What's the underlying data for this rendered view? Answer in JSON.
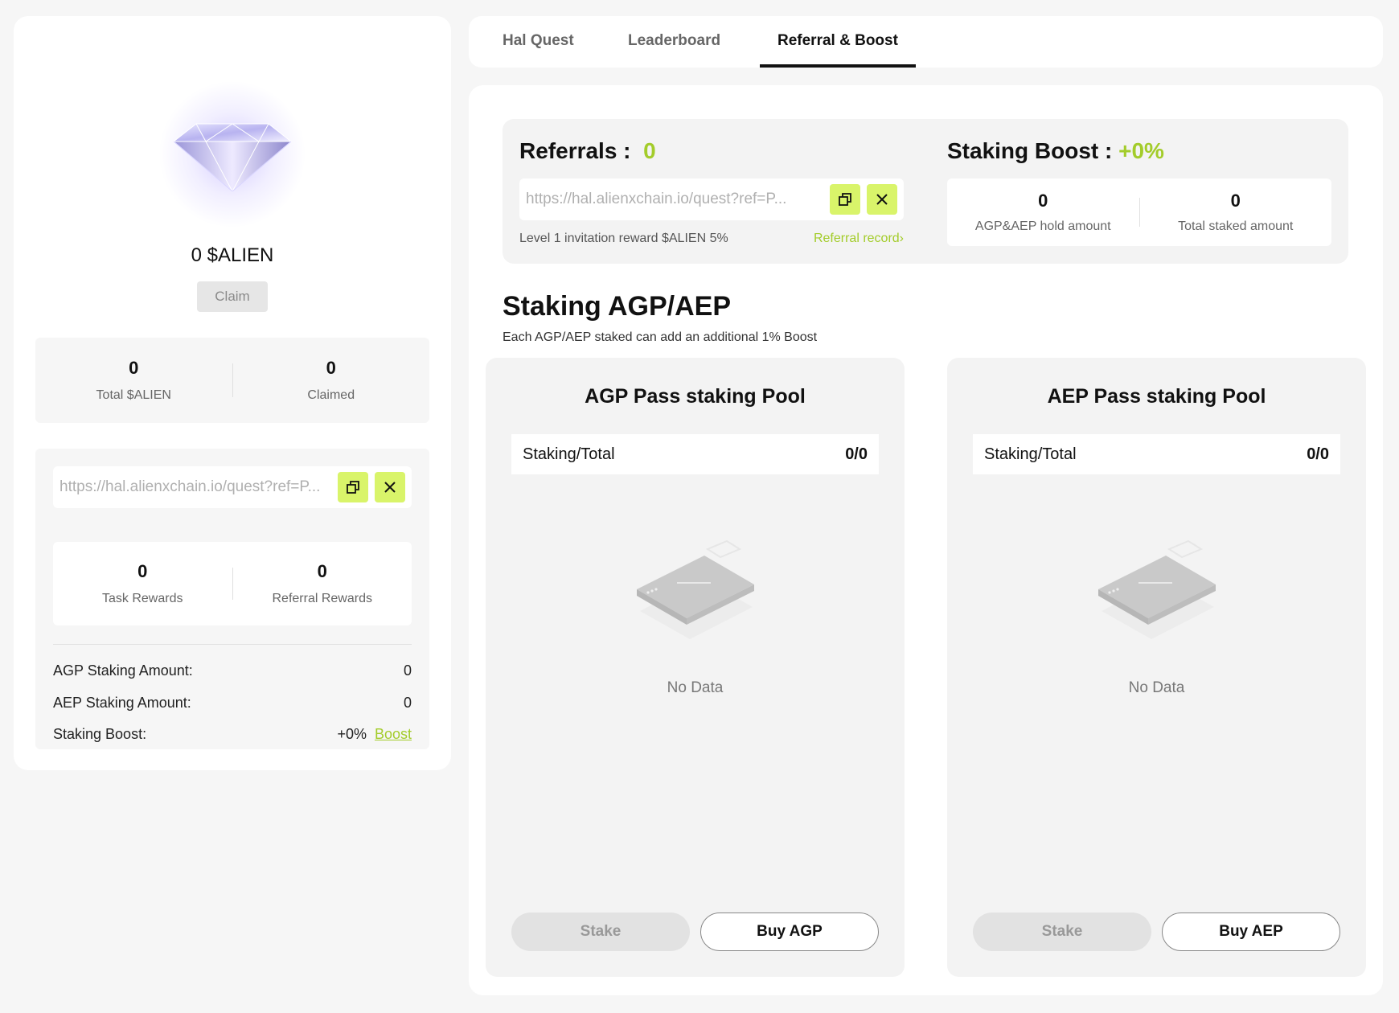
{
  "left_panel": {
    "alien_amount": "0 $ALIEN",
    "claim_label": "Claim",
    "stats": [
      {
        "value": "0",
        "label": "Total $ALIEN"
      },
      {
        "value": "0",
        "label": "Claimed"
      }
    ],
    "referral_link": "https://hal.alienxchain.io/quest?ref=P...",
    "rewards": [
      {
        "value": "0",
        "label": "Task Rewards"
      },
      {
        "value": "0",
        "label": "Referral Rewards"
      }
    ],
    "agp_staking_label": "AGP Staking Amount:",
    "agp_staking_value": "0",
    "aep_staking_label": "AEP Staking Amount:",
    "aep_staking_value": "0",
    "staking_boost_label": "Staking Boost:",
    "staking_boost_value": "+0%",
    "boost_link": "Boost"
  },
  "tabs": [
    {
      "label": "Hal Quest",
      "active": false
    },
    {
      "label": "Leaderboard",
      "active": false
    },
    {
      "label": "Referral & Boost",
      "active": true
    }
  ],
  "referrals": {
    "title": "Referrals :",
    "count": "0",
    "link": "https://hal.alienxchain.io/quest?ref=P...",
    "invite_text": "Level 1 invitation reward $ALIEN 5%",
    "record_link": "Referral record›"
  },
  "staking_boost": {
    "title": "Staking Boost :",
    "value": "+0%",
    "hold_value": "0",
    "hold_label": "AGP&AEP hold amount",
    "staked_value": "0",
    "staked_label": "Total staked amount"
  },
  "staking": {
    "title": "Staking AGP/AEP",
    "subtitle": "Each AGP/AEP staked can add an additional 1% Boost"
  },
  "pools": [
    {
      "title": "AGP Pass staking Pool",
      "row_label": "Staking/Total",
      "row_value": "0/0",
      "empty_text": "No Data",
      "stake_label": "Stake",
      "buy_label": "Buy AGP"
    },
    {
      "title": "AEP Pass staking Pool",
      "row_label": "Staking/Total",
      "row_value": "0/0",
      "empty_text": "No Data",
      "stake_label": "Stake",
      "buy_label": "Buy AEP"
    }
  ],
  "colors": {
    "accent": "#d9f46a",
    "accent_text": "#a3cc2a",
    "background": "#f6f6f6"
  }
}
